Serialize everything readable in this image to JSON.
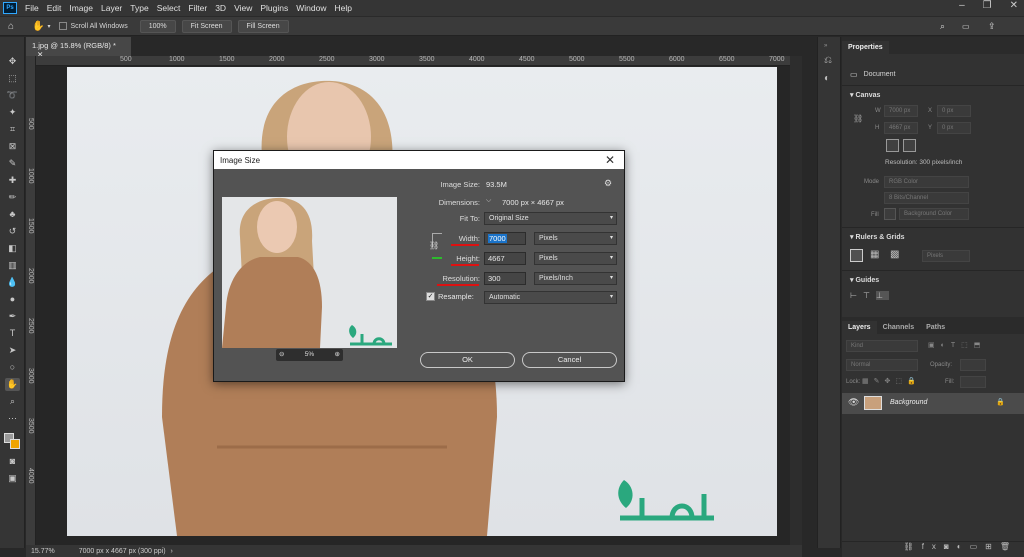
{
  "menubar": {
    "logo": "Ps",
    "items": [
      "File",
      "Edit",
      "Image",
      "Layer",
      "Type",
      "Select",
      "Filter",
      "3D",
      "View",
      "Plugins",
      "Window",
      "Help"
    ]
  },
  "options": {
    "scroll_all": "Scroll All Windows",
    "zoom": "100%",
    "fit_screen": "Fit Screen",
    "fill_screen": "Fill Screen"
  },
  "document": {
    "tab_title": "1.jpg @ 15.8% (RGB/8) *",
    "ruler_top": [
      "500",
      "1000",
      "1500",
      "2000",
      "2500",
      "3000",
      "3500",
      "4000",
      "4500",
      "5000",
      "5500",
      "6000",
      "6500",
      "7000"
    ],
    "ruler_left": [
      "500",
      "1000",
      "1500",
      "2000",
      "2500",
      "3000",
      "3500",
      "4000"
    ],
    "status_zoom": "15.77%",
    "status_info": "7000 px x 4667 px (300 ppi)",
    "watermark": "ﻻﻭﺍﺷ"
  },
  "dialog": {
    "title": "Image Size",
    "image_size_label": "Image Size:",
    "image_size_value": "93.5M",
    "dimensions_label": "Dimensions:",
    "dimensions_value": "7000 px  ×  4667 px",
    "fit_to_label": "Fit To:",
    "fit_to_value": "Original Size",
    "width_label": "Width:",
    "width_value": "7000",
    "width_unit": "Pixels",
    "height_label": "Height:",
    "height_value": "4667",
    "height_unit": "Pixels",
    "resolution_label": "Resolution:",
    "resolution_value": "300",
    "resolution_unit": "Pixels/Inch",
    "resample_label": "Resample:",
    "resample_value": "Automatic",
    "zoom_value": "5%",
    "ok": "OK",
    "cancel": "Cancel"
  },
  "properties": {
    "tab": "Properties",
    "doc_label": "Document",
    "canvas_title": "Canvas",
    "w_label": "W",
    "w_value": "7000 px",
    "h_label": "H",
    "h_value": "4667 px",
    "x_label": "X",
    "x_value": "0 px",
    "y_label": "Y",
    "y_value": "0 px",
    "resolution": "Resolution: 300 pixels/inch",
    "mode_label": "Mode",
    "mode_value": "RGB Color",
    "bits_value": "8 Bits/Channel",
    "fill_label": "Fill",
    "fill_value": "Background Color",
    "rulers_title": "Rulers & Grids",
    "rulers_unit": "Pixels",
    "guides_title": "Guides"
  },
  "layers": {
    "tabs": [
      "Layers",
      "Channels",
      "Paths"
    ],
    "kind": "Kind",
    "blend": "Normal",
    "opacity_label": "Opacity:",
    "lock_label": "Lock:",
    "fill_label": "Fill:",
    "layer_name": "Background"
  }
}
